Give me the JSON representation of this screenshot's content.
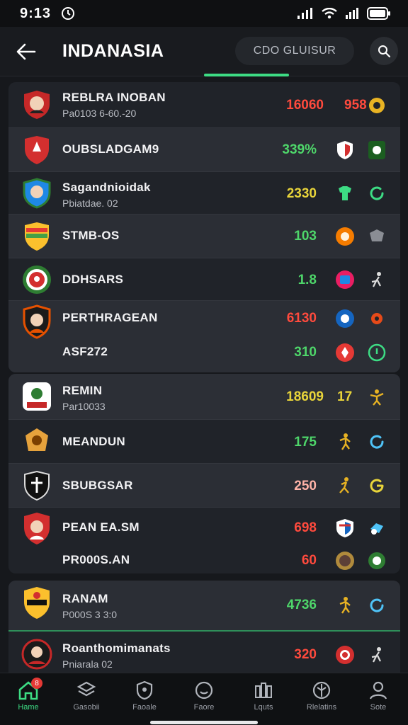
{
  "status": {
    "time": "9:13"
  },
  "header": {
    "title": "INDANASIA",
    "search_placeholder": "CDO GLUISUR"
  },
  "groups": [
    {
      "rows": [
        {
          "name": "REBLRA INOBAN",
          "sub": "Pa0103 6-60.-20",
          "score": "16060",
          "score2": "958"
        },
        {
          "name": "OUBSLADGAM9",
          "score": "339%"
        },
        {
          "name": "Sagandnioidak",
          "sub": "Pbiatdae. 02",
          "score": "2330"
        },
        {
          "name": "STMB-OS",
          "score": "103"
        },
        {
          "name": "DDHSARS",
          "score": "1.8"
        },
        {
          "name": "PERTHRAGEAN",
          "score": "6130"
        },
        {
          "name": "ASF272",
          "score": "310"
        }
      ]
    },
    {
      "rows": [
        {
          "name": "REMIN",
          "sub": "Par10033",
          "score": "18609",
          "score2": "17"
        },
        {
          "name": "MEANDUN",
          "score": "175"
        },
        {
          "name": "SBUBGSAR",
          "score": "250"
        },
        {
          "name": "PEAN EA.SM",
          "score": "698"
        },
        {
          "name": "PR000S.AN",
          "score": "60"
        }
      ]
    },
    {
      "rows": [
        {
          "name": "RANAM",
          "sub": "P000S 3 3:0",
          "score": "4736"
        },
        {
          "name": "Roanthomimanats",
          "sub": "Pniarala 02",
          "score": "320"
        }
      ]
    }
  ],
  "nav": [
    {
      "label": "Hame"
    },
    {
      "label": "Gasobii"
    },
    {
      "label": "Faoale"
    },
    {
      "label": "Faore"
    },
    {
      "label": "Lquts"
    },
    {
      "label": "Rlelatins"
    },
    {
      "label": "Sote"
    }
  ],
  "nav_badge": "8",
  "colors": {
    "accent": "#3ddc84",
    "loss": "#ff4a3d",
    "win": "#4ed66a",
    "draw": "#e8d43a"
  }
}
